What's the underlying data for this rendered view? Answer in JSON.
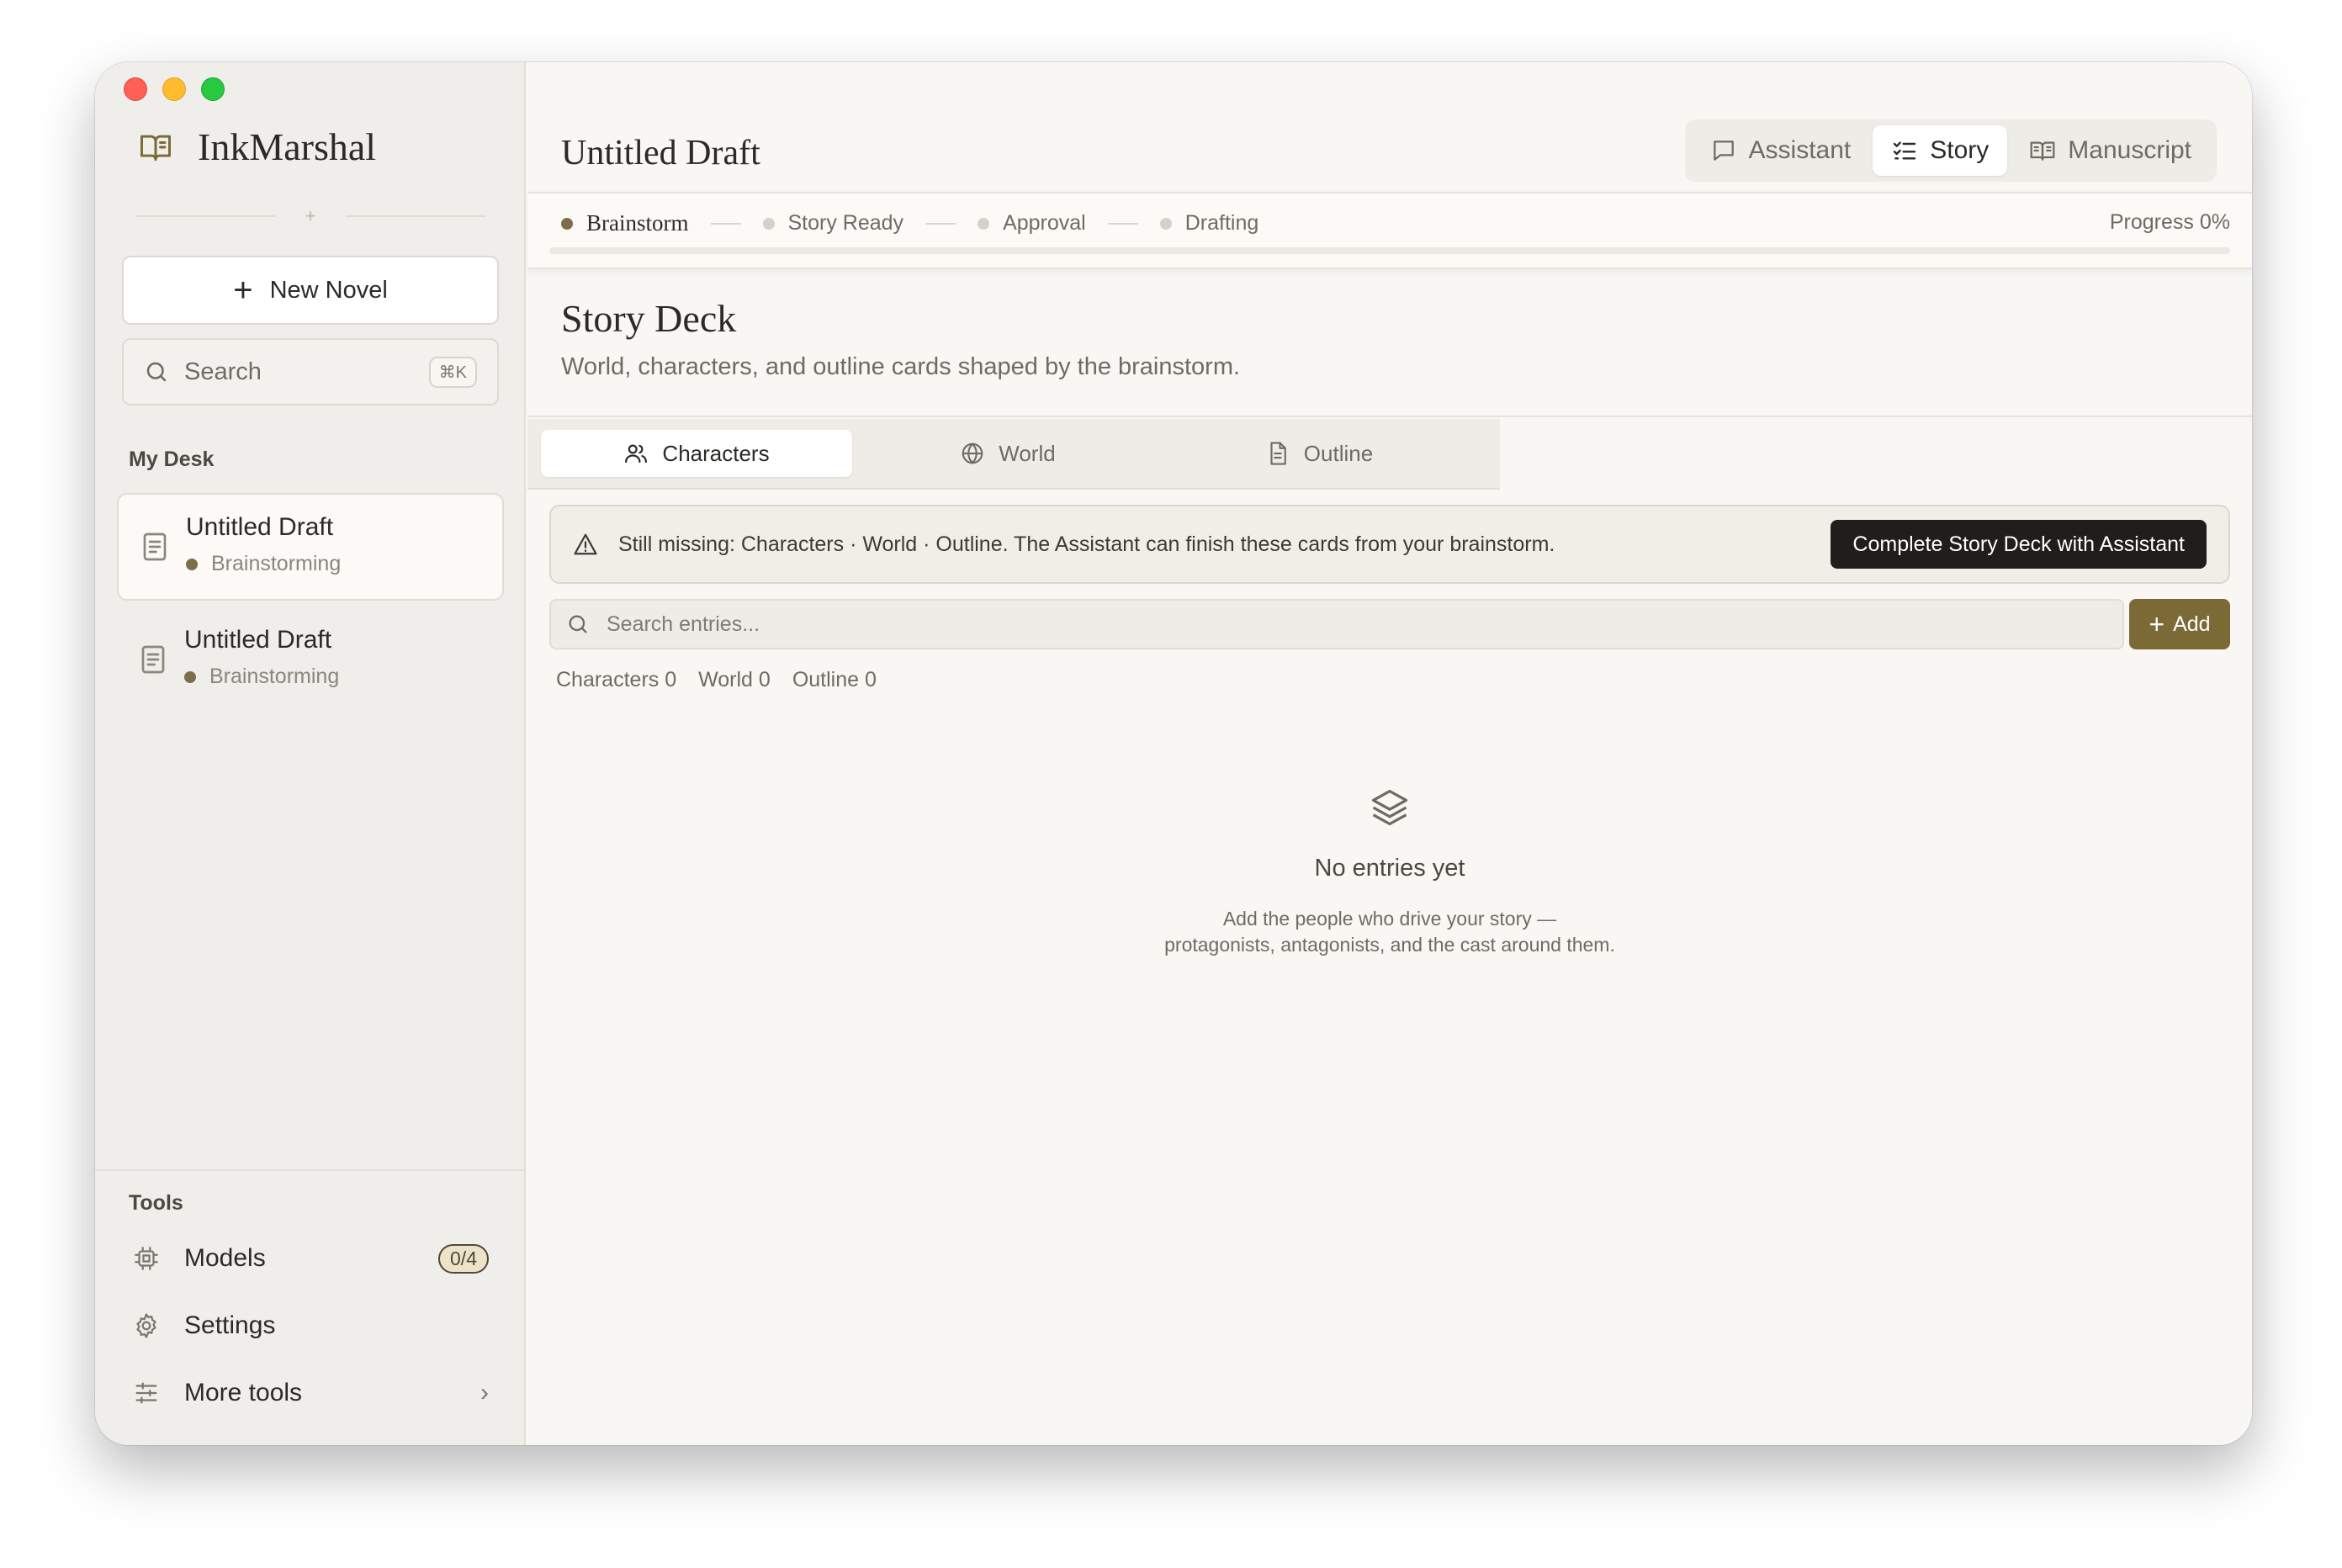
{
  "app": {
    "name": "InkMarshal"
  },
  "sidebar": {
    "new_novel_label": "New Novel",
    "search": {
      "placeholder": "Search",
      "shortcut": "⌘K"
    },
    "desk_label": "My Desk",
    "documents": [
      {
        "title": "Untitled Draft",
        "status": "Brainstorming",
        "active": true
      },
      {
        "title": "Untitled Draft",
        "status": "Brainstorming",
        "active": false
      }
    ],
    "tools_label": "Tools",
    "tools": [
      {
        "label": "Models",
        "badge": "0/4",
        "icon": "chip-icon"
      },
      {
        "label": "Settings",
        "icon": "gear-icon"
      },
      {
        "label": "More tools",
        "icon": "sliders-icon"
      }
    ]
  },
  "header": {
    "title": "Untitled Draft",
    "modes": [
      {
        "label": "Assistant",
        "icon": "chat-icon",
        "active": false
      },
      {
        "label": "Story",
        "icon": "checklist-icon",
        "active": true
      },
      {
        "label": "Manuscript",
        "icon": "book-icon",
        "active": false
      }
    ]
  },
  "pipeline": {
    "steps": [
      {
        "label": "Brainstorm",
        "active": true
      },
      {
        "label": "Story Ready",
        "active": false
      },
      {
        "label": "Approval",
        "active": false
      },
      {
        "label": "Drafting",
        "active": false
      }
    ],
    "progress_label": "Progress 0%",
    "progress_value": 0
  },
  "deck": {
    "title": "Story Deck",
    "subtitle": "World, characters, and outline cards shaped by the brainstorm.",
    "tabs": [
      {
        "label": "Characters",
        "icon": "users-icon",
        "active": true
      },
      {
        "label": "World",
        "icon": "globe-icon",
        "active": false
      },
      {
        "label": "Outline",
        "icon": "document-icon",
        "active": false
      }
    ],
    "notice": {
      "text": "Still missing: Characters · World · Outline. The Assistant can finish these cards from your brainstorm.",
      "button": "Complete Story Deck with Assistant"
    },
    "entry_search_placeholder": "Search entries...",
    "add_label": "Add",
    "counts": [
      "Characters 0",
      "World 0",
      "Outline 0"
    ],
    "empty": {
      "title": "No entries yet",
      "line1": "Add the people who drive your story —",
      "line2": "protagonists, antagonists, and the cast around them."
    }
  },
  "colors": {
    "accent": "#7b6a35",
    "status_dot": "#7d6e4b",
    "dark_button": "#1f1e1b"
  }
}
